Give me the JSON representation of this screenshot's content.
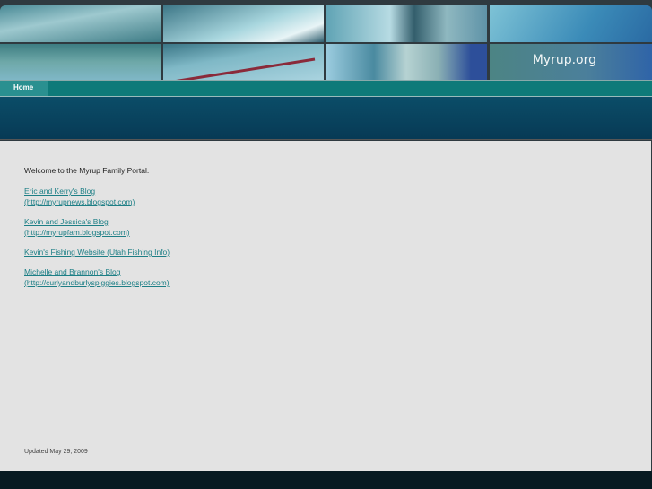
{
  "header": {
    "site_title": "Myrup.org"
  },
  "nav": {
    "items": [
      {
        "label": "Home"
      }
    ]
  },
  "content": {
    "welcome": "Welcome to the Myrup Family Portal.",
    "links": [
      {
        "title": "Eric and Kerry's Blog ",
        "url": "(http://myrupnews.blogspot.com)"
      },
      {
        "title": "Kevin and Jessica's Blog ",
        "url": "(http://myrupfam.blogspot.com)"
      },
      {
        "title": "Kevin's Fishing Website (Utah Fishing Info)"
      },
      {
        "title": "Michelle and Brannon's Blog ",
        "url": "(http://curlyandburlyspiggies.blogspot.com)"
      }
    ],
    "updated": "Updated May 29, 2009"
  }
}
